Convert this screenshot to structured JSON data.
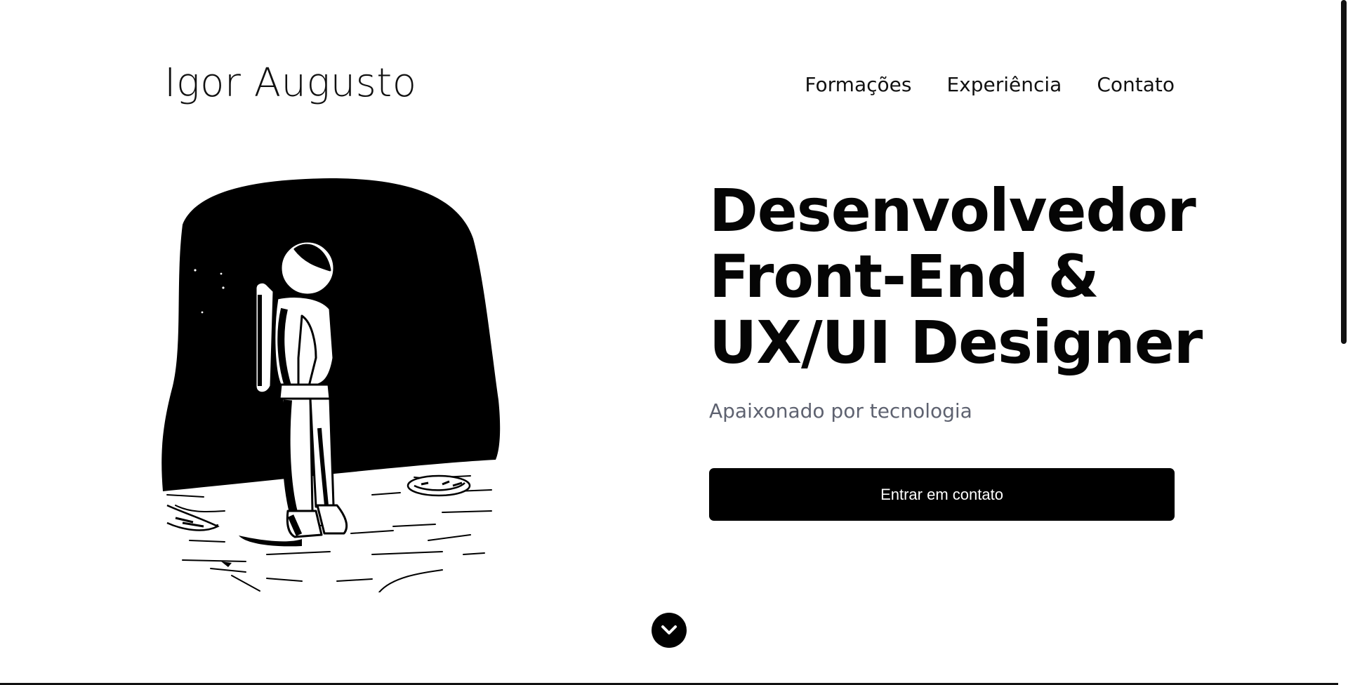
{
  "header": {
    "brand": "Igor Augusto",
    "nav": [
      {
        "label": "Formações"
      },
      {
        "label": "Experiência"
      },
      {
        "label": "Contato"
      }
    ]
  },
  "hero": {
    "title_lines": [
      "Desenvolvedor",
      "Front-End &",
      "UX/UI Designer"
    ],
    "subtitle": "Apaixonado por tecnologia",
    "cta_label": "Entrar em contato"
  },
  "icons": {
    "scroll_down": "chevron-down-icon",
    "illustration": "astronaut-on-moon"
  },
  "colors": {
    "background": "#ffffff",
    "text": "#111111",
    "subtitle": "#5e6270",
    "button_bg": "#000000",
    "button_text": "#ffffff"
  }
}
